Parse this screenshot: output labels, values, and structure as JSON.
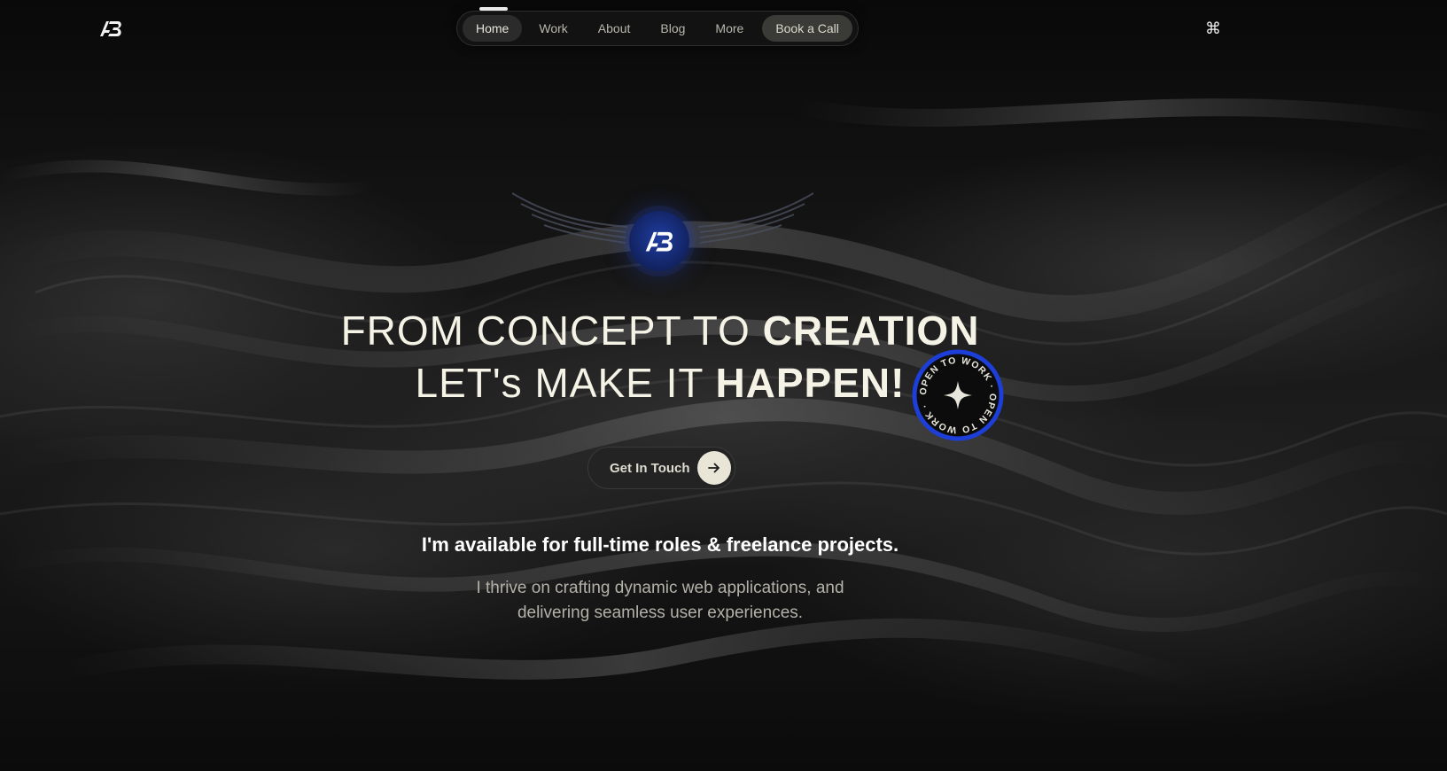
{
  "nav": {
    "items": [
      {
        "label": "Home",
        "active": true
      },
      {
        "label": "Work"
      },
      {
        "label": "About"
      },
      {
        "label": "Blog"
      },
      {
        "label": "More"
      }
    ],
    "cta_label": "Book a Call"
  },
  "header": {
    "logo_text": "AB",
    "command_icon": "⌘"
  },
  "hero": {
    "badge_text": "AB",
    "line1_light": "FROM CONCEPT TO ",
    "line1_bold": "CREATION",
    "line2_light": "LET's MAKE IT ",
    "line2_bold": "HAPPEN!",
    "stamp_text": "OPEN TO WORK · OPEN TO WORK · ",
    "button_label": "Get In Touch",
    "button_icon": "arrow-right-icon"
  },
  "availability": {
    "headline": "I'm available for full-time roles & freelance projects.",
    "description_line1": "I thrive on crafting dynamic web applications, and",
    "description_line2": "delivering seamless user experiences."
  },
  "colors": {
    "background": "#0a0a0a",
    "text": "#f5f2e6",
    "accent_blue": "#1d3fd8",
    "button_circle": "#e9e6d8"
  }
}
